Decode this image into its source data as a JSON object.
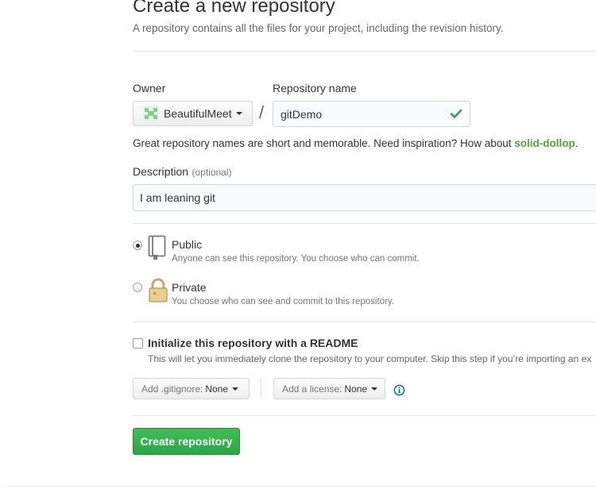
{
  "header": {
    "title": "Create a new repository",
    "subtitle": "A repository contains all the files for your project, including the revision history."
  },
  "owner": {
    "label": "Owner",
    "name": "BeautifulMeet",
    "avatar_icon": "identicon-avatar"
  },
  "repository": {
    "label": "Repository name",
    "separator": "/",
    "value": "gitDemo",
    "valid_icon": "check-icon",
    "hint_prefix": "Great repository names are short and memorable. Need inspiration? How about ",
    "suggestion": "solid-dollop",
    "hint_suffix": "."
  },
  "description": {
    "label": "Description",
    "optional": "(optional)",
    "value": "I am leaning git"
  },
  "visibility": {
    "selected": "public",
    "public": {
      "title": "Public",
      "note": "Anyone can see this repository. You choose who can commit.",
      "icon": "repo-book-icon"
    },
    "private": {
      "title": "Private",
      "note": "You choose who can see and commit to this repository.",
      "icon": "lock-icon"
    }
  },
  "init": {
    "title": "Initialize this repository with a README",
    "note": "This will let you immediately clone the repository to your computer. Skip this step if you’re importing an ex",
    "checked": false
  },
  "gitignore": {
    "label": "Add .gitignore:",
    "value": "None"
  },
  "license": {
    "label": "Add a license:",
    "value": "None",
    "info_icon": "info-icon"
  },
  "submit": {
    "label": "Create repository"
  },
  "colors": {
    "accent_green": "#28a745",
    "suggestion_green": "#55a532",
    "info_blue": "#0366d6",
    "border": "#d1d5da"
  }
}
